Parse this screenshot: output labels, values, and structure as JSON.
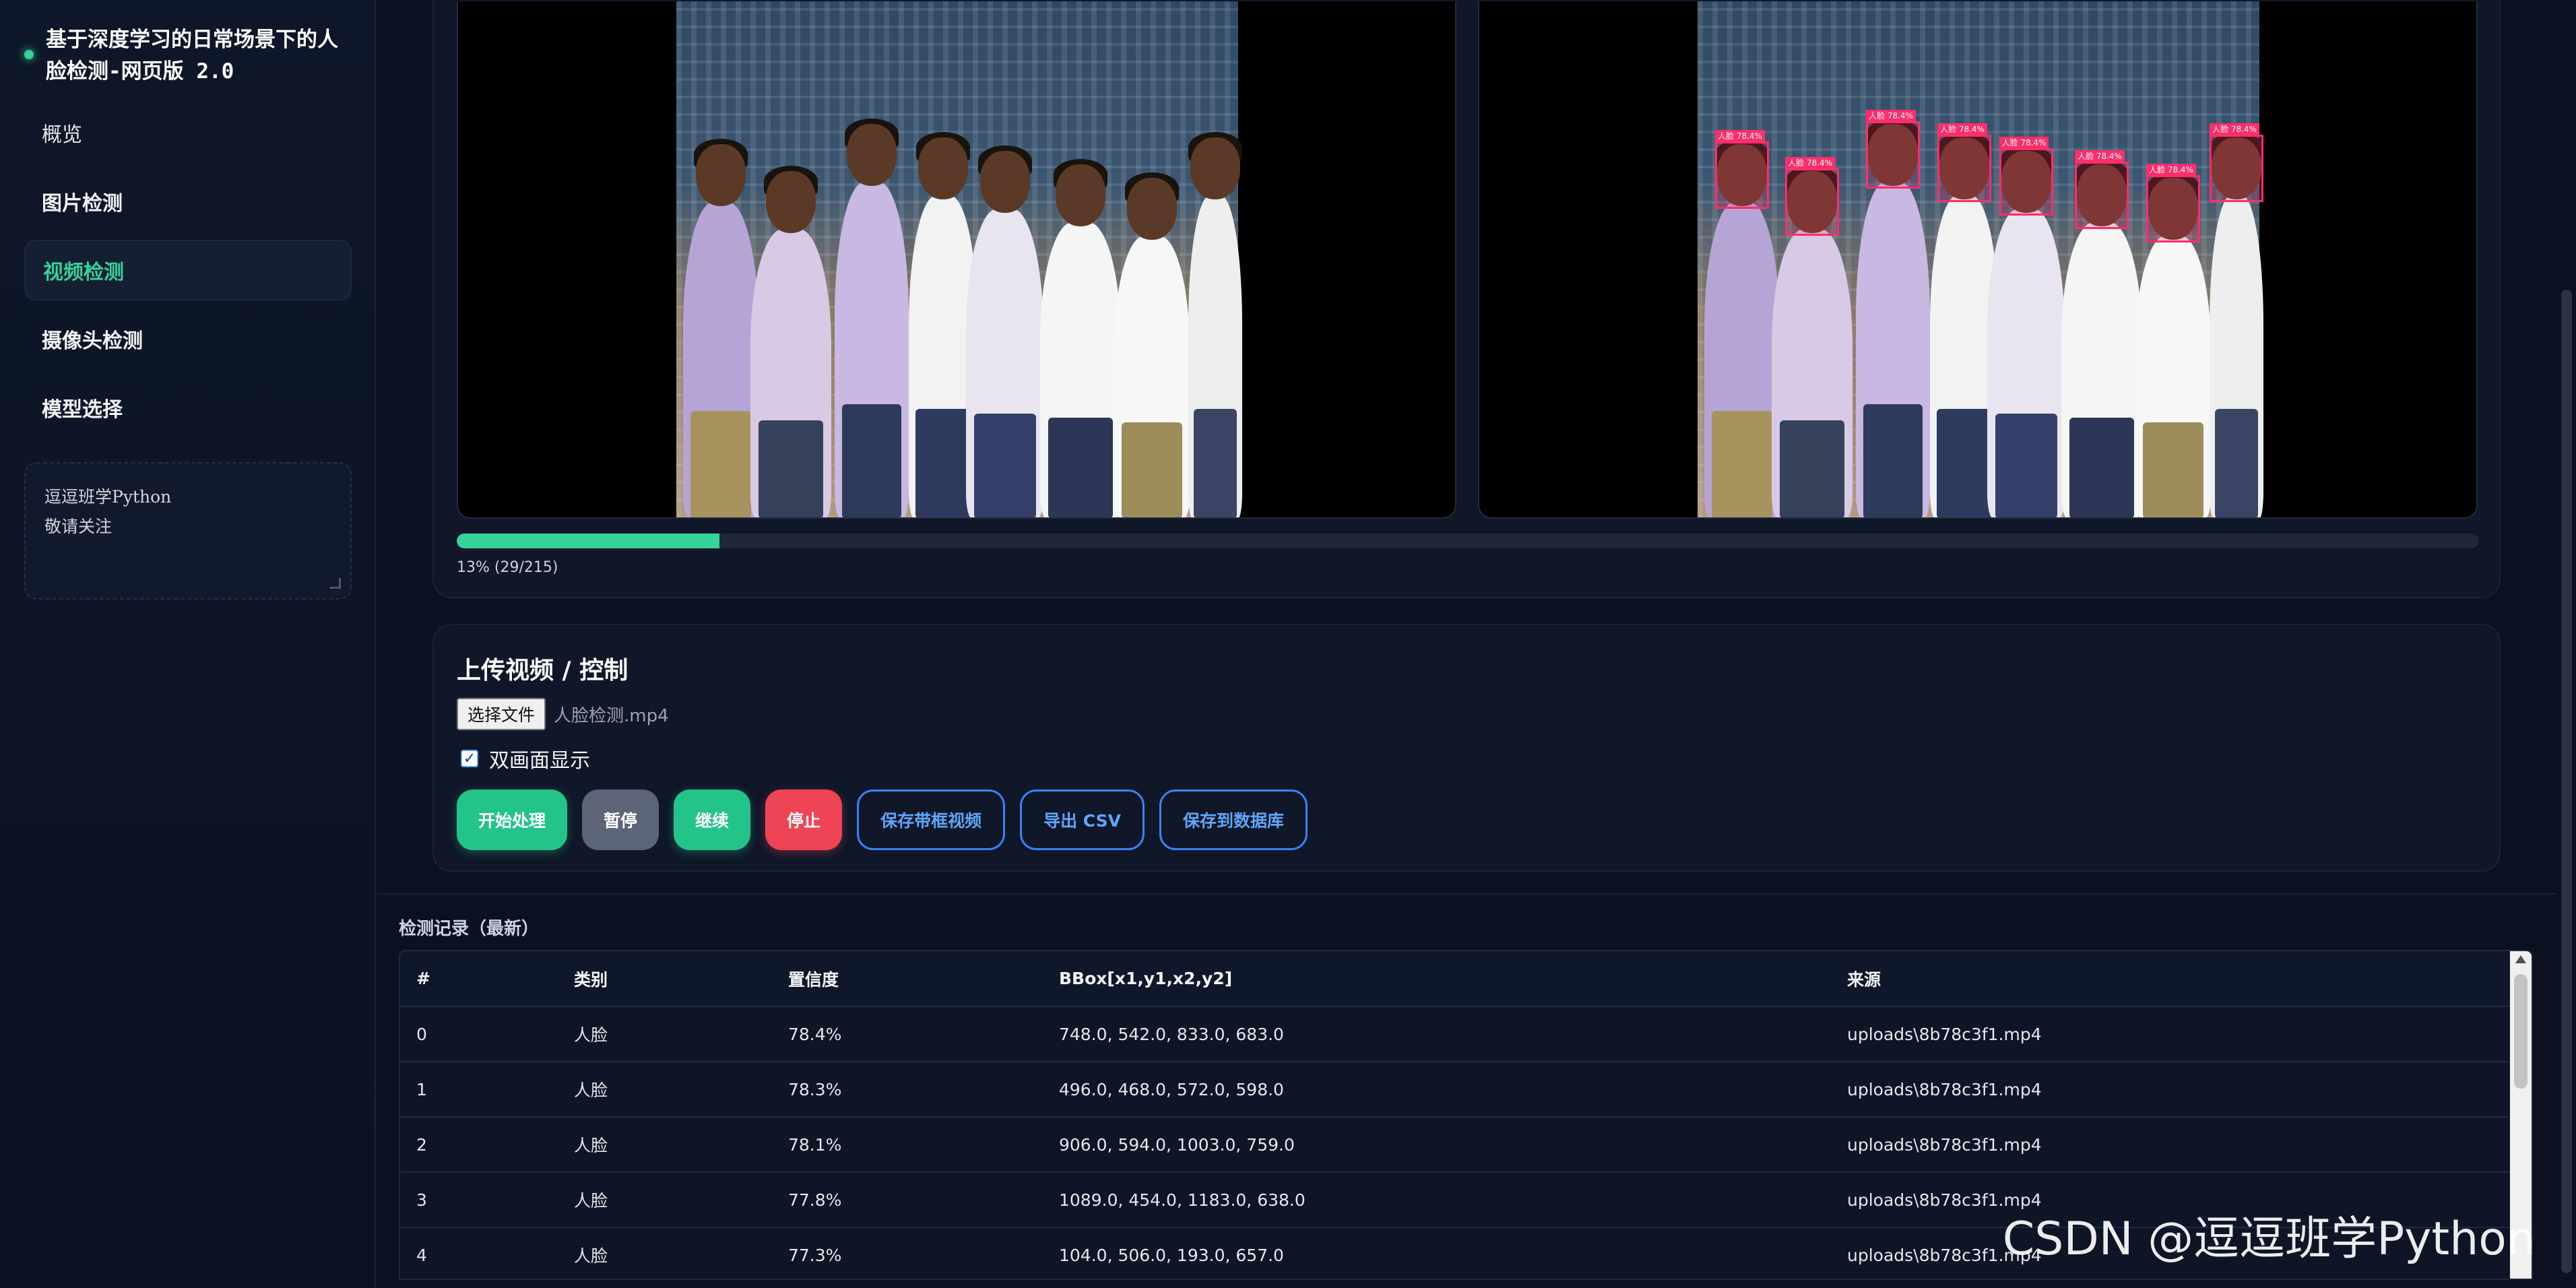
{
  "sidebar": {
    "title": "基于深度学习的日常场景下的人脸检测-网页版 2.0",
    "items": [
      {
        "label": "概览"
      },
      {
        "label": "图片检测"
      },
      {
        "label": "视频检测"
      },
      {
        "label": "摄像头检测"
      },
      {
        "label": "模型选择"
      }
    ],
    "active_index": 2,
    "note_line1": "逗逗班学Python",
    "note_line2": "敬请关注"
  },
  "video": {
    "progress_fraction": 0.13,
    "progress_text": "13% (29/215)",
    "detection_label": "人脸 78.4%"
  },
  "controls": {
    "title": "上传视频 / 控制",
    "file_button": "选择文件",
    "file_name": "人脸检测.mp4",
    "dual_view_label": "双画面显示",
    "dual_view_checked": true,
    "buttons": {
      "start": "开始处理",
      "pause": "暂停",
      "resume": "继续",
      "stop": "停止",
      "save_video": "保存带框视频",
      "export_csv": "导出 CSV",
      "save_db": "保存到数据库"
    }
  },
  "records": {
    "title": "检测记录（最新）",
    "columns": [
      "#",
      "类别",
      "置信度",
      "BBox[x1,y1,x2,y2]",
      "来源"
    ],
    "rows": [
      [
        "0",
        "人脸",
        "78.4%",
        "748.0, 542.0, 833.0, 683.0",
        "uploads\\8b78c3f1.mp4"
      ],
      [
        "1",
        "人脸",
        "78.3%",
        "496.0, 468.0, 572.0, 598.0",
        "uploads\\8b78c3f1.mp4"
      ],
      [
        "2",
        "人脸",
        "78.1%",
        "906.0, 594.0, 1003.0, 759.0",
        "uploads\\8b78c3f1.mp4"
      ],
      [
        "3",
        "人脸",
        "77.8%",
        "1089.0, 454.0, 1183.0, 638.0",
        "uploads\\8b78c3f1.mp4"
      ],
      [
        "4",
        "人脸",
        "77.3%",
        "104.0, 506.0, 193.0, 657.0",
        "uploads\\8b78c3f1.mp4"
      ]
    ]
  },
  "watermark": "CSDN @逗逗班学Python",
  "colors": {
    "accent": "#34d399",
    "background": "#0b1120",
    "danger": "#ef4455",
    "outline": "#3b82f6",
    "facebox": "#ff2d6b"
  }
}
